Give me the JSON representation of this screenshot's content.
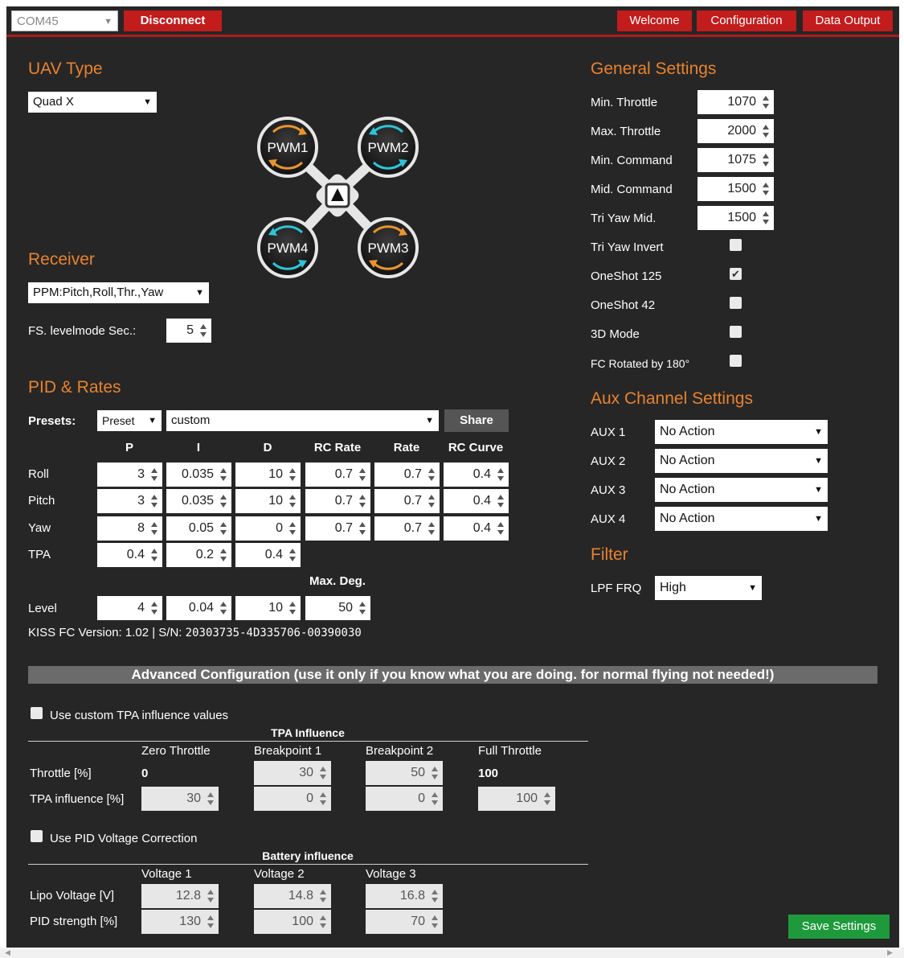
{
  "header": {
    "port": "COM45",
    "disconnect": "Disconnect",
    "nav": [
      "Welcome",
      "Configuration",
      "Data Output"
    ]
  },
  "uav": {
    "title": "UAV Type",
    "type": "Quad X",
    "motors": [
      "PWM1",
      "PWM2",
      "PWM3",
      "PWM4"
    ]
  },
  "receiver": {
    "title": "Receiver",
    "mode": "PPM:Pitch,Roll,Thr.,Yaw",
    "fs_label": "FS. levelmode Sec.:",
    "fs_value": "5"
  },
  "pid": {
    "title": "PID & Rates",
    "presets_label": "Presets:",
    "preset_select": "Preset",
    "preset_name": "custom",
    "share": "Share",
    "columns": [
      "P",
      "I",
      "D",
      "RC Rate",
      "Rate",
      "RC Curve"
    ],
    "rows": [
      {
        "label": "Roll",
        "values": [
          "3",
          "0.035",
          "10",
          "0.7",
          "0.7",
          "0.4"
        ]
      },
      {
        "label": "Pitch",
        "values": [
          "3",
          "0.035",
          "10",
          "0.7",
          "0.7",
          "0.4"
        ]
      },
      {
        "label": "Yaw",
        "values": [
          "8",
          "0.05",
          "0",
          "0.7",
          "0.7",
          "0.4"
        ]
      },
      {
        "label": "TPA",
        "values": [
          "0.4",
          "0.2",
          "0.4"
        ]
      }
    ],
    "maxdeg_label": "Max. Deg.",
    "level": {
      "label": "Level",
      "values": [
        "4",
        "0.04",
        "10",
        "50"
      ]
    },
    "version_label": "KISS FC Version: 1.02 | S/N: ",
    "serial": "20303735-4D335706-00390030"
  },
  "general": {
    "title": "General Settings",
    "numeric": [
      {
        "label": "Min. Throttle",
        "value": "1070"
      },
      {
        "label": "Max. Throttle",
        "value": "2000"
      },
      {
        "label": "Min. Command",
        "value": "1075"
      },
      {
        "label": "Mid. Command",
        "value": "1500"
      },
      {
        "label": "Tri Yaw Mid.",
        "value": "1500"
      }
    ],
    "checks": [
      {
        "label": "Tri Yaw Invert",
        "checked": false
      },
      {
        "label": "OneShot 125",
        "checked": true
      },
      {
        "label": "OneShot 42",
        "checked": false
      },
      {
        "label": "3D Mode",
        "checked": false
      },
      {
        "label": "FC Rotated by 180°",
        "checked": false
      }
    ]
  },
  "aux": {
    "title": "Aux Channel Settings",
    "channels": [
      {
        "label": "AUX 1",
        "value": "No Action"
      },
      {
        "label": "AUX 2",
        "value": "No Action"
      },
      {
        "label": "AUX 3",
        "value": "No Action"
      },
      {
        "label": "AUX 4",
        "value": "No Action"
      }
    ]
  },
  "filter": {
    "title": "Filter",
    "label": "LPF FRQ",
    "value": "High"
  },
  "advanced": {
    "banner": "Advanced Configuration (use it only if you know what you are doing. for normal flying not needed!)",
    "tpa_check": "Use custom TPA influence values",
    "tpa_header": "TPA Influence",
    "tpa_columns": [
      "Zero Throttle",
      "Breakpoint 1",
      "Breakpoint 2",
      "Full Throttle"
    ],
    "throttle_label": "Throttle [%]",
    "throttle_values": [
      "0",
      "30",
      "50",
      "100"
    ],
    "influence_label": "TPA influence [%]",
    "influence_values": [
      "30",
      "0",
      "0",
      "100"
    ],
    "volt_check": "Use PID Voltage Correction",
    "battery_header": "Battery influence",
    "volt_columns": [
      "Voltage 1",
      "Voltage 2",
      "Voltage 3"
    ],
    "lipo_label": "Lipo Voltage [V]",
    "lipo_values": [
      "12.8",
      "14.8",
      "16.8"
    ],
    "strength_label": "PID strength [%]",
    "strength_values": [
      "130",
      "100",
      "70"
    ]
  },
  "save": "Save Settings",
  "colors": {
    "accent": "#e8832f",
    "red": "#c21c1c",
    "green": "#1e9a3c",
    "bg": "#262626",
    "arrow_orange": "#e8952f",
    "arrow_cyan": "#2ec4d6"
  }
}
